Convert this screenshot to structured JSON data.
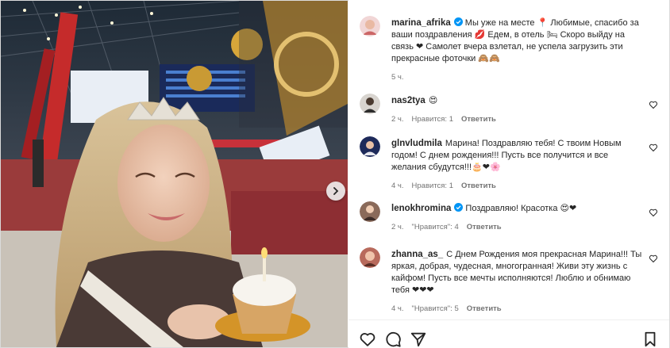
{
  "post": {
    "author": "marina_afrika",
    "caption": "Мы уже на месте 📍 Любимые, спасибо за ваши поздравления 💋 Едем, в отель 🛏 Скоро выйду на связь ❤ Самолет вчера взлетал, не успела загрузить эти прекрасные фоточки 🙈🙈",
    "time": "5 ч."
  },
  "comments": [
    {
      "user": "nas2tya",
      "text": "😍",
      "time": "2 ч.",
      "likes": "Нравится: 1",
      "reply": "Ответить",
      "verified": false
    },
    {
      "user": "glnvludmila",
      "text": "Марина! Поздравляю тебя! С твоим Новым годом! С днем рождения!!! Пусть все получится и все желания сбудутся!!!🎂❤🌸",
      "time": "4 ч.",
      "likes": "Нравится: 1",
      "reply": "Ответить",
      "verified": false
    },
    {
      "user": "lenokhromina",
      "text": "Поздравляю! Красотка 😍❤",
      "time": "2 ч.",
      "likes": "\"Нравится\": 4",
      "reply": "Ответить",
      "verified": true
    },
    {
      "user": "zhanna_as_",
      "text": "С Днем Рождения моя прекрасная Марина!!! Ты яркая, добрая, чудесная, многогранная! Живи эту жизнь с кайфом! Пусть все мечты исполняются! Люблю и обнимаю тебя ❤❤❤",
      "time": "4 ч.",
      "likes": "\"Нравится\": 5",
      "reply": "Ответить",
      "verified": false
    }
  ],
  "icons": {
    "like": "heart-outline-icon",
    "comment": "comment-bubble-icon",
    "share": "paper-plane-icon",
    "save": "bookmark-icon",
    "carousel": "chevron-right-icon",
    "verified": "verified-badge-icon"
  },
  "colors": {
    "verified": "#0095f6",
    "muted": "#737373",
    "text": "#262626"
  }
}
